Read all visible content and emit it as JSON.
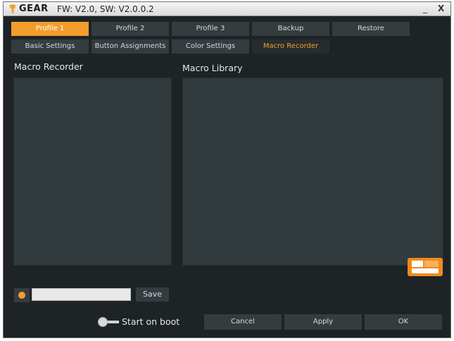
{
  "titlebar": {
    "logo_text": "GEAR",
    "firmware": "FW: V2.0, SW: V2.0.0.2",
    "minimize": "_",
    "close": "X"
  },
  "profile_tabs": [
    {
      "label": "Profile 1",
      "active": true
    },
    {
      "label": "Profile 2",
      "active": false
    },
    {
      "label": "Profile 3",
      "active": false
    },
    {
      "label": "Backup",
      "active": false
    },
    {
      "label": "Restore",
      "active": false
    }
  ],
  "section_tabs": [
    {
      "label": "Basic Settings",
      "active": false
    },
    {
      "label": "Button Assignments",
      "active": false
    },
    {
      "label": "Color Settings",
      "active": false
    },
    {
      "label": "Macro Recorder",
      "active": true
    }
  ],
  "macro_recorder": {
    "title": "Macro Recorder"
  },
  "macro_library": {
    "title": "Macro Library"
  },
  "recorder_controls": {
    "name_value": "",
    "save_label": "Save"
  },
  "boot": {
    "label": "Start on boot",
    "enabled": false
  },
  "footer": {
    "cancel_label": "Cancel",
    "apply_label": "Apply",
    "ok_label": "OK"
  },
  "colors": {
    "accent": "#f39d2d",
    "background": "#1e2326",
    "panel": "#313b3e",
    "button": "#353c40",
    "text": "#d5d9db"
  },
  "icons": {
    "logo": "fnatic-logo-icon",
    "record": "record-dot-icon",
    "brand": "brand-mark-icon"
  }
}
